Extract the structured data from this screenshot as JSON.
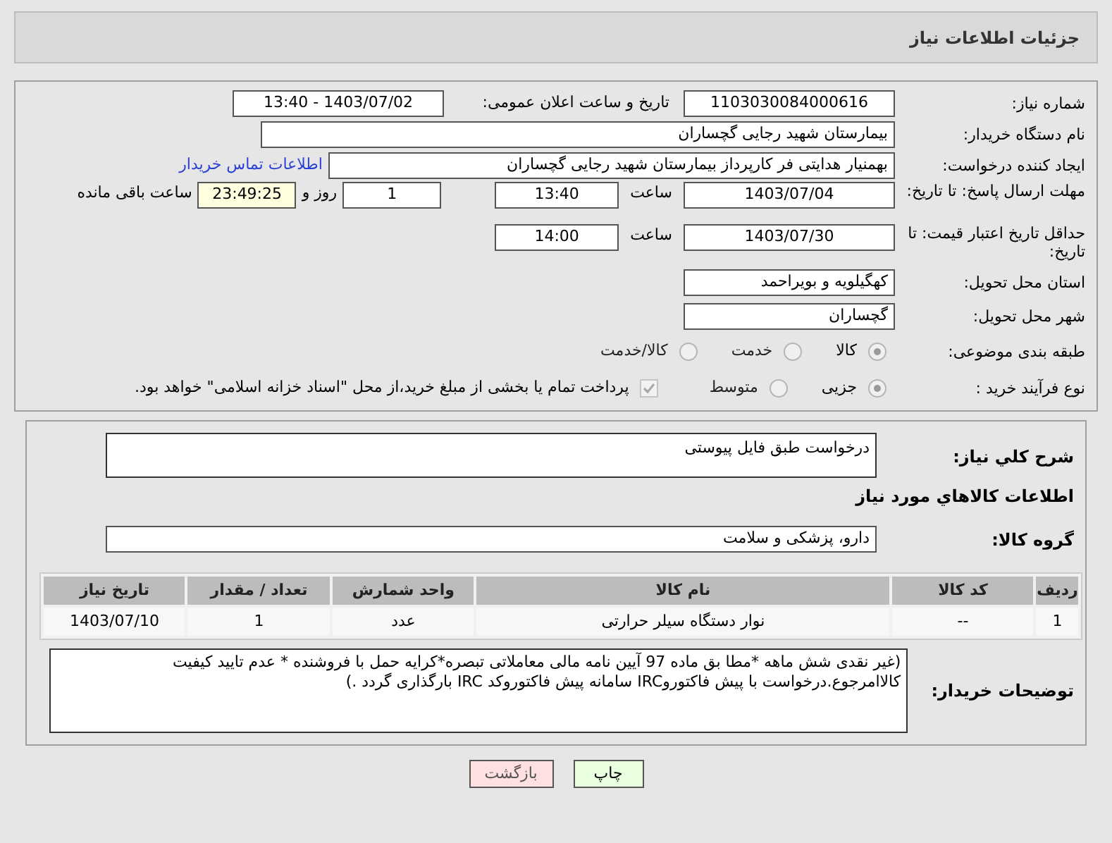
{
  "header": {
    "title": "جزئیات اطلاعات نیاز"
  },
  "need_number": {
    "label": "شماره نیاز:",
    "value": "1103030084000616"
  },
  "announce": {
    "label": "تاریخ و ساعت اعلان عمومی:",
    "value": "1403/07/02 - 13:40"
  },
  "buyer_org": {
    "label": "نام دستگاه خریدار:",
    "value": "بیمارستان شهید رجایی گچساران"
  },
  "requester": {
    "label": "ایجاد کننده درخواست:",
    "value": "بهمنیار هدایتی فر کارپرداز بیمارستان شهید رجایی گچساران",
    "link": "اطلاعات تماس خریدار"
  },
  "response_deadline": {
    "label": "مهلت ارسال پاسخ: تا تاریخ:",
    "date": "1403/07/04",
    "time_label": "ساعت",
    "time": "13:40",
    "days": "1",
    "days_label": "روز و",
    "remaining": "23:49:25",
    "remaining_label": "ساعت باقی مانده"
  },
  "price_validity": {
    "label": "حداقل تاریخ اعتبار قیمت: تا تاریخ:",
    "date": "1403/07/30",
    "time_label": "ساعت",
    "time": "14:00"
  },
  "province": {
    "label": "استان محل تحویل:",
    "value": "کهگیلویه و بویراحمد"
  },
  "city": {
    "label": "شهر محل تحویل:",
    "value": "گچساران"
  },
  "category": {
    "label": "طبقه بندی موضوعی:",
    "options": [
      {
        "label": "کالا",
        "selected": true
      },
      {
        "label": "خدمت",
        "selected": false
      },
      {
        "label": "کالا/خدمت",
        "selected": false
      }
    ]
  },
  "process": {
    "label": "نوع فرآیند خرید :",
    "options": [
      {
        "label": "جزیی",
        "selected": true
      },
      {
        "label": "متوسط",
        "selected": false
      }
    ],
    "payment_note": {
      "checked": true,
      "text": "پرداخت تمام یا بخشی از مبلغ خرید،از محل \"اسناد خزانه اسلامی\" خواهد بود."
    }
  },
  "description": {
    "label": "شرح كلي نياز:",
    "value": "درخواست طبق فایل پیوستی"
  },
  "goods_heading": "اطلاعات كالاهاي مورد نياز",
  "goods_group": {
    "label": "گروه کالا:",
    "value": "دارو، پزشکی و سلامت"
  },
  "table": {
    "columns": [
      "ردیف",
      "کد کالا",
      "نام کالا",
      "واحد شمارش",
      "تعداد / مقدار",
      "تاریخ نیاز"
    ],
    "rows": [
      [
        "1",
        "--",
        "نوار دستگاه سیلر حرارتی",
        "عدد",
        "1",
        "1403/07/10"
      ]
    ]
  },
  "buyer_notes": {
    "label": "توضیحات خریدار:",
    "value": "(غیر نقدی شش ماهه  *مطا بق ماده 97 آیین نامه مالی معاملاتی تبصره*کرایه حمل با فروشنده * عدم تایید کیفیت کالاامرجوع.درخواست با پیش فاکتوروIRC سامانه  پیش فاکتوروکد IRC بارگذاری گردد .)"
  },
  "buttons": [
    {
      "label": "چاپ",
      "kind": "print"
    },
    {
      "label": "بازگشت",
      "kind": "back"
    }
  ]
}
